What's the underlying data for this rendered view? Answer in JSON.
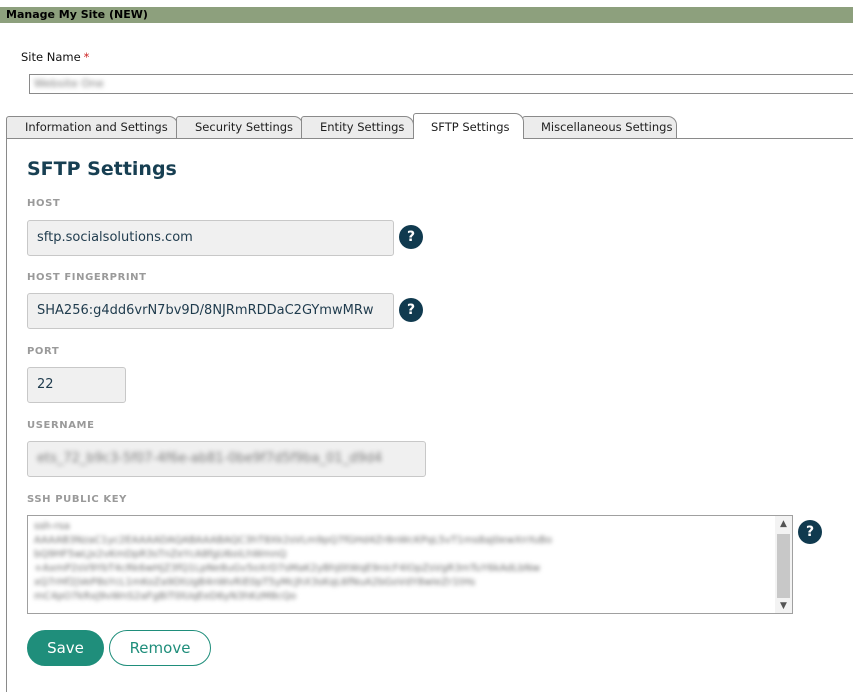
{
  "window": {
    "title": "Manage My Site (NEW)"
  },
  "site_name": {
    "label": "Site Name",
    "required_marker": "*",
    "value": "Website One"
  },
  "tabs": [
    {
      "label": "Information and Settings",
      "active": false
    },
    {
      "label": "Security Settings",
      "active": false
    },
    {
      "label": "Entity Settings",
      "active": false
    },
    {
      "label": "SFTP Settings",
      "active": true
    },
    {
      "label": "Miscellaneous Settings",
      "active": false
    }
  ],
  "sftp": {
    "heading": "SFTP Settings",
    "host": {
      "label": "HOST",
      "value": "sftp.socialsolutions.com",
      "help": "?"
    },
    "fingerprint": {
      "label": "HOST FINGERPRINT",
      "value": "SHA256:g4dd6vrN7bv9D/8NJRmRDDaC2GYmwMRw",
      "help": "?"
    },
    "port": {
      "label": "PORT",
      "value": "22"
    },
    "username": {
      "label": "USERNAME",
      "value": "ets_72_b9c3-5f07-4f6e-ab81-0be9f7d5f9ba_01_d9d4"
    },
    "ssh_key": {
      "label": "SSH PUBLIC KEY",
      "help": "?",
      "lines": [
        "ssh-rsa",
        "AAAAB3NzaC1yc2EAAAADAQABAAABAQC3hT8Xk2sVLm9pQ7fGHd4Zr8nWcKPqL5vT1ms8aJ0ewXnYuBo",
        "bQ9HF5wLJx2vKmDpR3sTnZeYcA8fgU6oiLhWmnQ",
        "+AxmP2sV9YbT4cRk6wHjZ3fQ1LpNe8uGv5oXrD7sMaK2yBhJ0tWqE9nIcF4lOpZsVgR3mTuY6kAdLbNw",
        "xQ7rHf2jVeP8sYcL1mKoZa9DtUgB4nWvRiE0pT5yMcJhX3sKqL6fNuA2bGoVdY8wIeZr1tHs",
        "mC4pO7kRxJ9vWnS2aFgBiT0lUqEeD6yN3hKzM8cQo"
      ],
      "scroll_up": "▲",
      "scroll_down": "▼"
    },
    "save_label": "Save",
    "remove_label": "Remove"
  }
}
